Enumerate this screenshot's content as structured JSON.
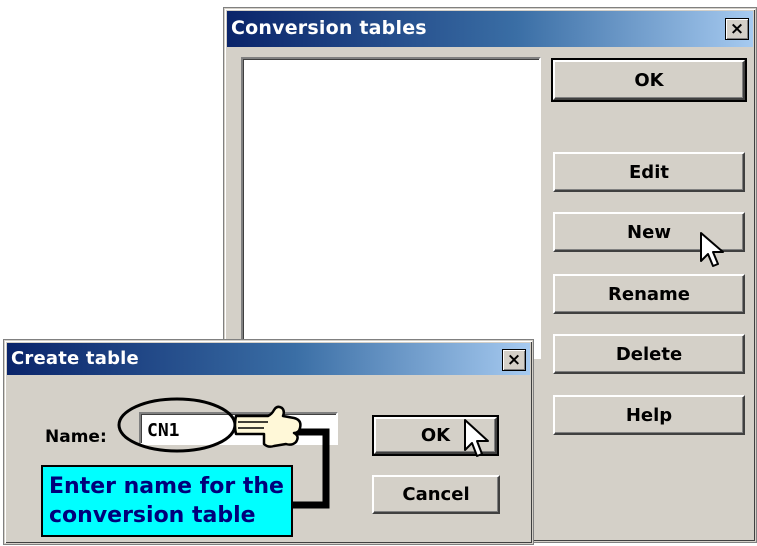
{
  "conversion_tables": {
    "title": "Conversion tables",
    "close_glyph": "×",
    "list_items": [],
    "buttons": {
      "ok": "OK",
      "edit": "Edit",
      "new": "New",
      "rename": "Rename",
      "delete": "Delete",
      "help": "Help"
    }
  },
  "create_table": {
    "title": "Create table",
    "close_glyph": "×",
    "name_label": "Name:",
    "name_value": "CN1",
    "ok": "OK",
    "cancel": "Cancel"
  },
  "annotation": {
    "line1": "Enter name for the",
    "line2": "conversion table"
  },
  "colors": {
    "titlebar_start": "#0a246a",
    "titlebar_end": "#a6caf0",
    "callout_bg": "#00ffff",
    "callout_text": "#00007a",
    "dialog_bg": "#d4d0c8"
  },
  "icons": {
    "arrow_cursor": "arrow-pointer",
    "hand_pointer": "pointing-hand",
    "highlight": "ellipse-highlight",
    "connector": "callout-connector"
  }
}
